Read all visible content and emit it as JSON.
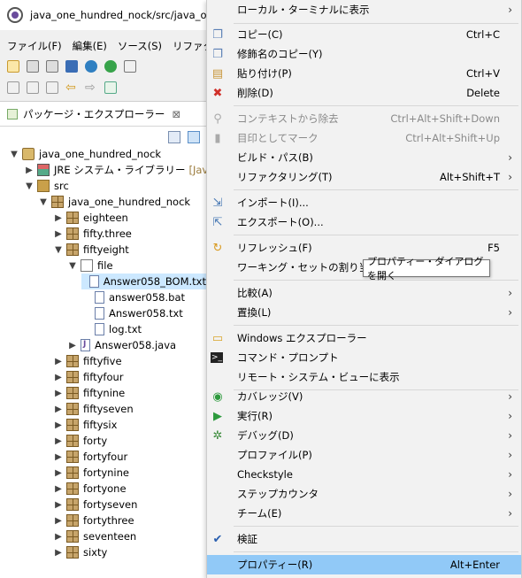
{
  "window": {
    "title": "java_one_hundred_nock/src/java_one_"
  },
  "menubar": {
    "items": [
      "ファイル(F)",
      "編集(E)",
      "ソース(S)",
      "リファクタリン"
    ]
  },
  "panel": {
    "tab_label": "パッケージ・エクスプローラー",
    "tree": [
      {
        "label": "java_one_hundred_nock",
        "icon": "project-icon",
        "arrow": "▼"
      },
      {
        "label": "JRE システム・ライブラリー",
        "suffix": "[JavaSE-11",
        "icon": "library-icon",
        "arrow": "▶"
      },
      {
        "label": "src",
        "icon": "source-folder-icon",
        "arrow": "▼"
      },
      {
        "label": "java_one_hundred_nock",
        "icon": "package-icon",
        "arrow": "▼"
      },
      {
        "label": "eighteen",
        "icon": "package-icon",
        "arrow": "▶"
      },
      {
        "label": "fifty.three",
        "icon": "package-icon",
        "arrow": "▶"
      },
      {
        "label": "fiftyeight",
        "icon": "package-icon",
        "arrow": "▼"
      },
      {
        "label": "file",
        "icon": "folder-icon",
        "arrow": "▼"
      },
      {
        "label": "Answer058_BOM.txt",
        "icon": "text-file-icon",
        "arrow": ""
      },
      {
        "label": "answer058.bat",
        "icon": "text-file-icon",
        "arrow": ""
      },
      {
        "label": "Answer058.txt",
        "icon": "text-file-icon",
        "arrow": ""
      },
      {
        "label": "log.txt",
        "icon": "text-file-icon",
        "arrow": ""
      },
      {
        "label": "Answer058.java",
        "icon": "java-file-icon",
        "arrow": "▶"
      },
      {
        "label": "fiftyfive",
        "icon": "package-icon",
        "arrow": "▶"
      },
      {
        "label": "fiftyfour",
        "icon": "package-icon",
        "arrow": "▶"
      },
      {
        "label": "fiftynine",
        "icon": "package-icon",
        "arrow": "▶"
      },
      {
        "label": "fiftyseven",
        "icon": "package-icon",
        "arrow": "▶"
      },
      {
        "label": "fiftysix",
        "icon": "package-icon",
        "arrow": "▶"
      },
      {
        "label": "forty",
        "icon": "package-icon",
        "arrow": "▶"
      },
      {
        "label": "fortyfour",
        "icon": "package-icon",
        "arrow": "▶"
      },
      {
        "label": "fortynine",
        "icon": "package-icon",
        "arrow": "▶"
      },
      {
        "label": "fortyone",
        "icon": "package-icon",
        "arrow": "▶"
      },
      {
        "label": "fortyseven",
        "icon": "package-icon",
        "arrow": "▶"
      },
      {
        "label": "fortythree",
        "icon": "package-icon",
        "arrow": "▶"
      },
      {
        "label": "seventeen",
        "icon": "package-icon",
        "arrow": "▶"
      },
      {
        "label": "sixty",
        "icon": "package-icon",
        "arrow": "▶"
      }
    ]
  },
  "context_menu": {
    "items": [
      {
        "label": "ローカル・ターミナルに表示",
        "shortcut": "",
        "submenu": true,
        "disabled": false,
        "icon": ""
      },
      {
        "label": "コピー(C)",
        "shortcut": "Ctrl+C",
        "submenu": false,
        "disabled": false,
        "icon": "copy-icon"
      },
      {
        "label": "修飾名のコピー(Y)",
        "shortcut": "",
        "submenu": false,
        "disabled": false,
        "icon": "copy-qualified-icon"
      },
      {
        "label": "貼り付け(P)",
        "shortcut": "Ctrl+V",
        "submenu": false,
        "disabled": false,
        "icon": "paste-icon"
      },
      {
        "label": "削除(D)",
        "shortcut": "Delete",
        "submenu": false,
        "disabled": false,
        "icon": "delete-icon"
      },
      {
        "label": "コンテキストから除去",
        "shortcut": "Ctrl+Alt+Shift+Down",
        "submenu": false,
        "disabled": true,
        "icon": "remove-context-icon"
      },
      {
        "label": "目印としてマーク",
        "shortcut": "Ctrl+Alt+Shift+Up",
        "submenu": false,
        "disabled": true,
        "icon": "mark-landmark-icon"
      },
      {
        "label": "ビルド・パス(B)",
        "shortcut": "",
        "submenu": true,
        "disabled": false,
        "icon": ""
      },
      {
        "label": "リファクタリング(T)",
        "shortcut": "Alt+Shift+T",
        "submenu": true,
        "disabled": false,
        "icon": ""
      },
      {
        "label": "インポート(I)...",
        "shortcut": "",
        "submenu": false,
        "disabled": false,
        "icon": "import-icon"
      },
      {
        "label": "エクスポート(O)...",
        "shortcut": "",
        "submenu": false,
        "disabled": false,
        "icon": "export-icon"
      },
      {
        "label": "リフレッシュ(F)",
        "shortcut": "F5",
        "submenu": false,
        "disabled": false,
        "icon": "refresh-icon"
      },
      {
        "label": "ワーキング・セットの割り当て(A)",
        "shortcut": "",
        "submenu": false,
        "disabled": false,
        "icon": ""
      },
      {
        "label": "比較(A)",
        "shortcut": "",
        "submenu": true,
        "disabled": false,
        "icon": ""
      },
      {
        "label": "置換(L)",
        "shortcut": "",
        "submenu": true,
        "disabled": false,
        "icon": ""
      },
      {
        "label": "Windows エクスプローラー",
        "shortcut": "",
        "submenu": false,
        "disabled": false,
        "icon": "windows-explorer-icon"
      },
      {
        "label": "コマンド・プロンプト",
        "shortcut": "",
        "submenu": false,
        "disabled": false,
        "icon": "command-prompt-icon"
      },
      {
        "label": "リモート・システム・ビューに表示",
        "shortcut": "",
        "submenu": false,
        "disabled": false,
        "icon": ""
      },
      {
        "label": "カバレッジ(V)",
        "shortcut": "",
        "submenu": true,
        "disabled": false,
        "icon": "coverage-icon"
      },
      {
        "label": "実行(R)",
        "shortcut": "",
        "submenu": true,
        "disabled": false,
        "icon": "run-icon"
      },
      {
        "label": "デバッグ(D)",
        "shortcut": "",
        "submenu": true,
        "disabled": false,
        "icon": "debug-icon"
      },
      {
        "label": "プロファイル(P)",
        "shortcut": "",
        "submenu": true,
        "disabled": false,
        "icon": ""
      },
      {
        "label": "Checkstyle",
        "shortcut": "",
        "submenu": true,
        "disabled": false,
        "icon": ""
      },
      {
        "label": "ステップカウンタ",
        "shortcut": "",
        "submenu": true,
        "disabled": false,
        "icon": ""
      },
      {
        "label": "チーム(E)",
        "shortcut": "",
        "submenu": true,
        "disabled": false,
        "icon": ""
      },
      {
        "label": "検証",
        "shortcut": "",
        "submenu": false,
        "disabled": false,
        "icon": "checkmark-icon"
      },
      {
        "label": "プロパティー(R)",
        "shortcut": "Alt+Enter",
        "submenu": false,
        "disabled": false,
        "icon": ""
      }
    ],
    "tooltip": "プロパティー・ダイアログを開く"
  },
  "colors": {
    "hover": "#91c9f7",
    "selection": "#cce8ff",
    "menu_bg": "#f2f2f2"
  }
}
